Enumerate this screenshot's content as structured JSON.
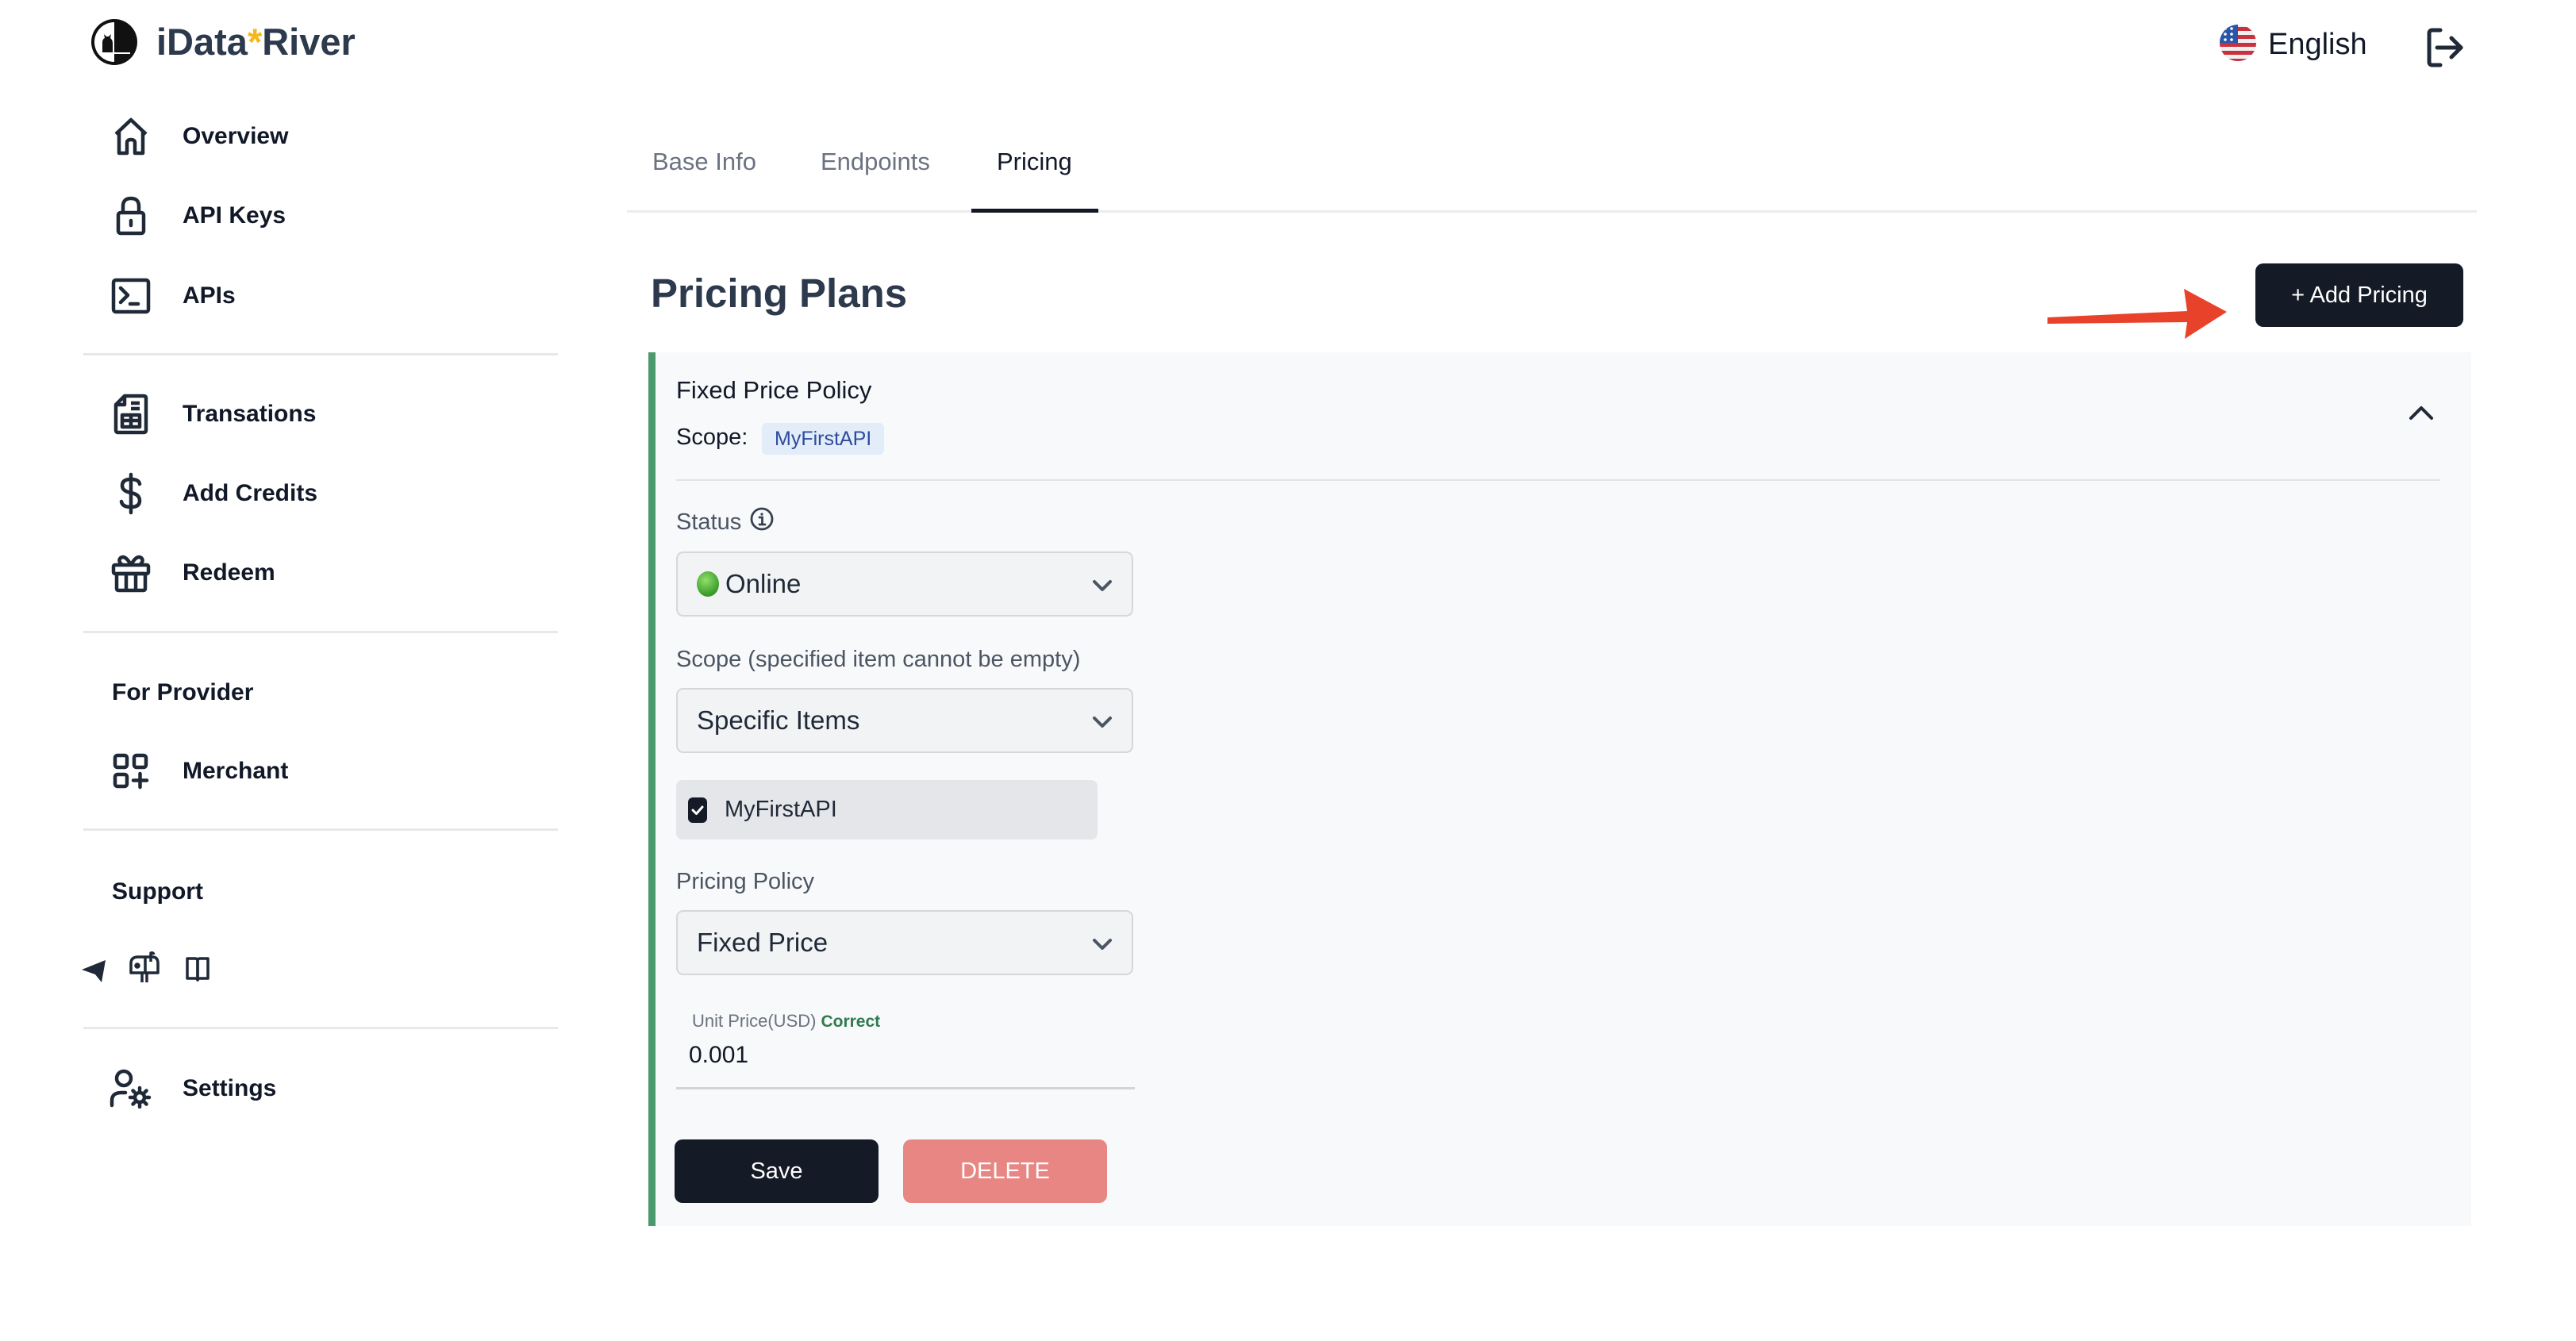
{
  "header": {
    "brand_prefix": "iData",
    "brand_star": "*",
    "brand_suffix": "River",
    "language": "English",
    "logout_icon": "logout-icon"
  },
  "sidebar": {
    "primary": [
      {
        "label": "Overview",
        "icon": "home-icon"
      },
      {
        "label": "API Keys",
        "icon": "lock-icon"
      },
      {
        "label": "APIs",
        "icon": "terminal-icon"
      }
    ],
    "account": [
      {
        "label": "Transations",
        "icon": "calculator-document-icon"
      },
      {
        "label": "Add Credits",
        "icon": "dollar-icon"
      },
      {
        "label": "Redeem",
        "icon": "gift-icon"
      }
    ],
    "provider_title": "For Provider",
    "provider": [
      {
        "label": "Merchant",
        "icon": "grid-plus-icon"
      }
    ],
    "support_title": "Support",
    "support_icons": [
      "telegram-icon",
      "mailbox-icon",
      "book-icon"
    ],
    "settings": {
      "label": "Settings",
      "icon": "user-gear-icon"
    }
  },
  "tabs": [
    {
      "label": "Base Info",
      "active": false
    },
    {
      "label": "Endpoints",
      "active": false
    },
    {
      "label": "Pricing",
      "active": true
    }
  ],
  "main": {
    "title": "Pricing Plans",
    "add_button": "+ Add Pricing",
    "annotation": "red-arrow pointing to Add Pricing"
  },
  "plan": {
    "title": "Fixed Price Policy",
    "scope_label": "Scope:",
    "scope_tag": "MyFirstAPI",
    "status_label": "Status",
    "status_value": "Online",
    "status_color": "#3a9a2a",
    "scope_field_label": "Scope (specified item cannot be empty)",
    "scope_value": "Specific Items",
    "items": [
      {
        "label": "MyFirstAPI",
        "checked": true
      }
    ],
    "policy_label": "Pricing Policy",
    "policy_value": "Fixed Price",
    "unit_price_label": "Unit Price(USD)",
    "unit_price_status": "Correct",
    "unit_price_value": "0.001",
    "save": "Save",
    "delete": "DELETE"
  },
  "colors": {
    "accent_dark": "#141a26",
    "card_border": "#4a9a6e",
    "delete": "#e88683",
    "arrow": "#e8432a",
    "brand_star": "#f5b81c"
  }
}
